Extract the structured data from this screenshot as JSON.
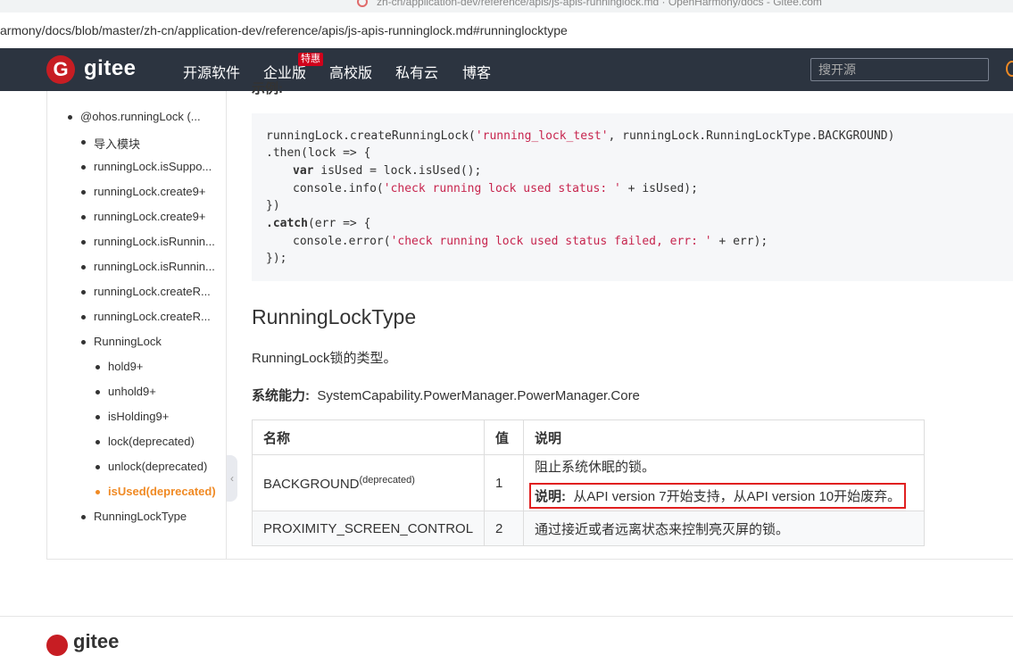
{
  "browser": {
    "tab_title": "zh-cn/application-dev/reference/apis/js-apis-runninglock.md · OpenHarmony/docs - Gitee.com",
    "url": "armony/docs/blob/master/zh-cn/application-dev/reference/apis/js-apis-runninglock.md#runninglocktype"
  },
  "nav": {
    "logo_letter": "G",
    "brand": "gitee",
    "items": [
      "开源软件",
      "企业版",
      "高校版",
      "私有云",
      "博客"
    ],
    "badge": "特惠",
    "search_placeholder": "搜开源"
  },
  "toc": {
    "items": [
      {
        "label": "@ohos.runningLock (...",
        "level": 0
      },
      {
        "label": "导入模块",
        "level": 1
      },
      {
        "label": "runningLock.isSuppo...",
        "level": 1
      },
      {
        "label": "runningLock.create9+",
        "level": 1
      },
      {
        "label": "runningLock.create9+",
        "level": 1
      },
      {
        "label": "runningLock.isRunnin...",
        "level": 1
      },
      {
        "label": "runningLock.isRunnin...",
        "level": 1
      },
      {
        "label": "runningLock.createR...",
        "level": 1
      },
      {
        "label": "runningLock.createR...",
        "level": 1
      },
      {
        "label": "RunningLock",
        "level": 1
      },
      {
        "label": "hold9+",
        "level": 2
      },
      {
        "label": "unhold9+",
        "level": 2
      },
      {
        "label": "isHolding9+",
        "level": 2
      },
      {
        "label": "lock(deprecated)",
        "level": 2
      },
      {
        "label": "unlock(deprecated)",
        "level": 2
      },
      {
        "label": "isUsed(deprecated)",
        "level": 2,
        "active": true
      },
      {
        "label": "RunningLockType",
        "level": 1
      }
    ],
    "collapse_glyph": "‹"
  },
  "content": {
    "partial_heading": "示例:",
    "code": {
      "l1a": "runningLock.createRunningLock(",
      "l1s": "'running_lock_test'",
      "l1b": ", runningLock.RunningLockType.BACKGROUND)",
      "l2": ".then(lock => {",
      "l3k": "var",
      "l3": " isUsed = lock.isUsed();",
      "l4a": "console.info(",
      "l4s": "'check running lock used status: '",
      "l4b": " + isUsed);",
      "l5": "})",
      "l6k": ".catch",
      "l6": "(err => {",
      "l7a": "console.error(",
      "l7s": "'check running lock used status failed, err: '",
      "l7b": " + err);",
      "l8": "});"
    },
    "heading": "RunningLockType",
    "description": "RunningLock锁的类型。",
    "syscap_label": "系统能力:",
    "syscap_value": "SystemCapability.PowerManager.PowerManager.Core",
    "table": {
      "headers": [
        "名称",
        "值",
        "说明"
      ],
      "rows": [
        {
          "name": "BACKGROUND",
          "sup": "(deprecated)",
          "value": "1",
          "desc": "阻止系统休眠的锁。",
          "note_label": "说明:",
          "note_text": "从API version 7开始支持，从API version 10开始废弃。"
        },
        {
          "name": "PROXIMITY_SCREEN_CONTROL",
          "value": "2",
          "desc": "通过接近或者远离状态来控制亮灭屏的锁。"
        }
      ]
    }
  },
  "footer": {
    "brand": "gitee"
  }
}
